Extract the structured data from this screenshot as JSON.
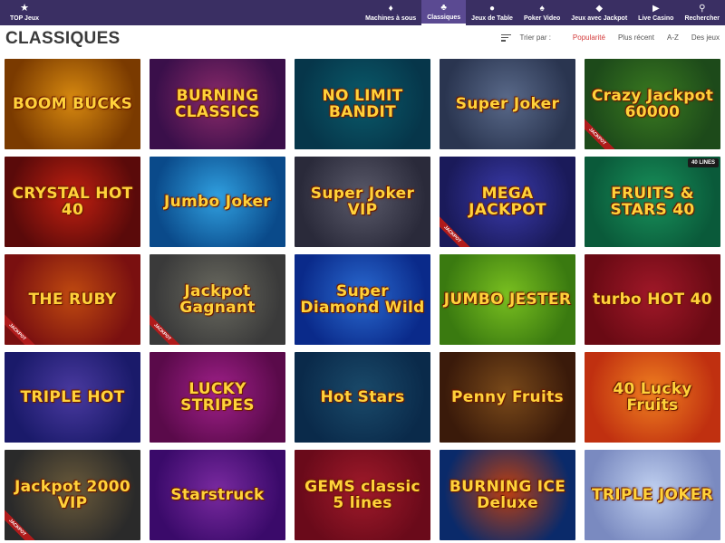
{
  "nav": {
    "top_jeux": {
      "label": "TOP Jeux",
      "icon": "star-icon"
    },
    "items": [
      {
        "label": "Machines à sous",
        "icon": "slot-machine-icon",
        "active": false
      },
      {
        "label": "Classiques",
        "icon": "cherries-icon",
        "active": true
      },
      {
        "label": "Jeux de Table",
        "icon": "chip-icon",
        "active": false
      },
      {
        "label": "Poker Video",
        "icon": "cards-icon",
        "active": false
      },
      {
        "label": "Jeux avec Jackpot",
        "icon": "jackpot-icon",
        "active": false
      },
      {
        "label": "Live Casino",
        "icon": "live-icon",
        "active": false
      },
      {
        "label": "Rechercher",
        "icon": "search-icon",
        "active": false
      }
    ]
  },
  "page": {
    "title": "CLASSIQUES",
    "sort_label": "Trier par :",
    "sort_options": [
      "Popularité",
      "Plus récent",
      "A-Z",
      "Des jeux"
    ],
    "active_sort": "Popularité"
  },
  "games": [
    {
      "title": "BOOM BUCKS",
      "bg": "#7a3a00",
      "bg2": "#d88a10",
      "badge": "",
      "tag": ""
    },
    {
      "title": "BURNING CLASSICS",
      "bg": "#3a0f4a",
      "bg2": "#8a2a6a",
      "badge": "",
      "tag": ""
    },
    {
      "title": "NO LIMIT BANDIT",
      "bg": "#06364a",
      "bg2": "#0a5a6a",
      "badge": "",
      "tag": ""
    },
    {
      "title": "Super Joker",
      "bg": "#2a3550",
      "bg2": "#5a6a8a",
      "badge": "",
      "tag": ""
    },
    {
      "title": "Crazy Jackpot 60000",
      "bg": "#1d4a1a",
      "bg2": "#3a7a20",
      "badge": "JACKPOT",
      "tag": ""
    },
    {
      "title": "CRYSTAL HOT 40",
      "bg": "#5a0a0a",
      "bg2": "#c02010",
      "badge": "",
      "tag": ""
    },
    {
      "title": "Jumbo Joker",
      "bg": "#0a4a8a",
      "bg2": "#30a0e0",
      "badge": "",
      "tag": ""
    },
    {
      "title": "Super Joker VIP",
      "bg": "#2a2a3a",
      "bg2": "#5a5a6a",
      "badge": "",
      "tag": ""
    },
    {
      "title": "MEGA JACKPOT",
      "bg": "#1a1a5a",
      "bg2": "#3a3aaa",
      "badge": "JACKPOT",
      "tag": ""
    },
    {
      "title": "FRUITS & STARS 40",
      "bg": "#0a5a3a",
      "bg2": "#18905a",
      "badge": "",
      "tag": "40 LINES"
    },
    {
      "title": "THE RUBY",
      "bg": "#7a1010",
      "bg2": "#c04a10",
      "badge": "JACKPOT",
      "tag": ""
    },
    {
      "title": "Jackpot Gagnant",
      "bg": "#3a3a3a",
      "bg2": "#6a6a60",
      "badge": "JACKPOT",
      "tag": ""
    },
    {
      "title": "Super Diamond Wild",
      "bg": "#0a2a8a",
      "bg2": "#2a6ad0",
      "badge": "",
      "tag": ""
    },
    {
      "title": "JUMBO JESTER",
      "bg": "#3a7a10",
      "bg2": "#7ac020",
      "badge": "",
      "tag": ""
    },
    {
      "title": "turbo HOT 40",
      "bg": "#6a0a14",
      "bg2": "#a01828",
      "badge": "",
      "tag": ""
    },
    {
      "title": "TRIPLE HOT",
      "bg": "#1a1a6a",
      "bg2": "#4a3aa0",
      "badge": "",
      "tag": ""
    },
    {
      "title": "LUCKY STRIPES",
      "bg": "#5a0a4a",
      "bg2": "#a0208a",
      "badge": "",
      "tag": ""
    },
    {
      "title": "Hot Stars",
      "bg": "#0a2a4a",
      "bg2": "#1a4a6a",
      "badge": "",
      "tag": ""
    },
    {
      "title": "Penny Fruits",
      "bg": "#3a1a0a",
      "bg2": "#7a4a1a",
      "badge": "",
      "tag": ""
    },
    {
      "title": "40 Lucky Fruits",
      "bg": "#c03010",
      "bg2": "#f08020",
      "badge": "",
      "tag": ""
    },
    {
      "title": "Jackpot 2000 VIP",
      "bg": "#2a2a2a",
      "bg2": "#6a5a3a",
      "badge": "JACKPOT",
      "tag": ""
    },
    {
      "title": "Starstruck",
      "bg": "#3a0a6a",
      "bg2": "#7a2aa0",
      "badge": "",
      "tag": ""
    },
    {
      "title": "GEMS classic 5 lines",
      "bg": "#6a0a1a",
      "bg2": "#a01a2a",
      "badge": "",
      "tag": ""
    },
    {
      "title": "BURNING ICE Deluxe",
      "bg": "#0a2a6a",
      "bg2": "#c04010",
      "badge": "",
      "tag": ""
    },
    {
      "title": "TRIPLE JOKER",
      "bg": "#7a8ac0",
      "bg2": "#c0d0f0",
      "badge": "",
      "tag": ""
    }
  ]
}
